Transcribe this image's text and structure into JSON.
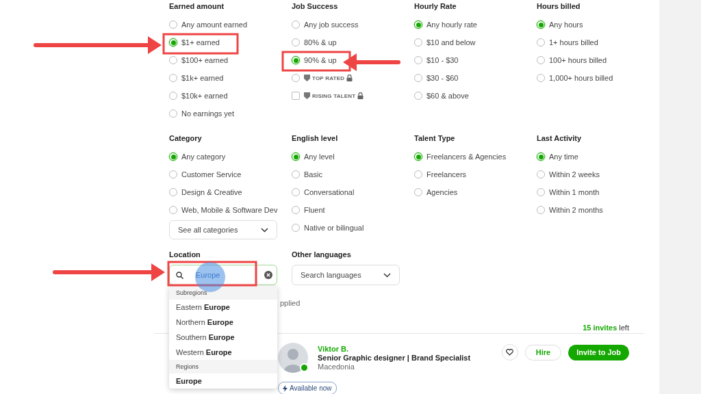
{
  "filters_top": [
    {
      "heading": "Earned amount",
      "options": [
        {
          "label": "Any amount earned",
          "kind": "radio",
          "selected": false
        },
        {
          "label": "$1+ earned",
          "kind": "radio",
          "selected": true
        },
        {
          "label": "$100+ earned",
          "kind": "radio",
          "selected": false
        },
        {
          "label": "$1k+ earned",
          "kind": "radio",
          "selected": false
        },
        {
          "label": "$10k+ earned",
          "kind": "radio",
          "selected": false
        },
        {
          "label": "No earnings yet",
          "kind": "radio",
          "selected": false
        }
      ]
    },
    {
      "heading": "Job Success",
      "options": [
        {
          "label": "Any job success",
          "kind": "radio",
          "selected": false
        },
        {
          "label": "80% & up",
          "kind": "radio",
          "selected": false
        },
        {
          "label": "90% & up",
          "kind": "radio",
          "selected": true
        },
        {
          "label": "TOP RATED",
          "kind": "radio",
          "selected": false,
          "locked": true
        },
        {
          "label": "RISING TALENT",
          "kind": "checkbox",
          "selected": false,
          "locked": true
        }
      ]
    },
    {
      "heading": "Hourly Rate",
      "options": [
        {
          "label": "Any hourly rate",
          "kind": "radio",
          "selected": true
        },
        {
          "label": "$10 and below",
          "kind": "radio",
          "selected": false
        },
        {
          "label": "$10 - $30",
          "kind": "radio",
          "selected": false
        },
        {
          "label": "$30 - $60",
          "kind": "radio",
          "selected": false
        },
        {
          "label": "$60 & above",
          "kind": "radio",
          "selected": false
        }
      ]
    },
    {
      "heading": "Hours billed",
      "options": [
        {
          "label": "Any hours",
          "kind": "radio",
          "selected": true
        },
        {
          "label": "1+ hours billed",
          "kind": "radio",
          "selected": false
        },
        {
          "label": "100+ hours billed",
          "kind": "radio",
          "selected": false
        },
        {
          "label": "1,000+ hours billed",
          "kind": "radio",
          "selected": false
        }
      ]
    }
  ],
  "filters_mid": [
    {
      "heading": "Category",
      "options": [
        {
          "label": "Any category",
          "kind": "radio",
          "selected": true
        },
        {
          "label": "Customer Service",
          "kind": "radio",
          "selected": false
        },
        {
          "label": "Design & Creative",
          "kind": "radio",
          "selected": false
        },
        {
          "label": "Web, Mobile & Software Dev",
          "kind": "radio",
          "selected": false
        }
      ],
      "select": "See all categories"
    },
    {
      "heading": "English level",
      "options": [
        {
          "label": "Any level",
          "kind": "radio",
          "selected": true
        },
        {
          "label": "Basic",
          "kind": "radio",
          "selected": false
        },
        {
          "label": "Conversational",
          "kind": "radio",
          "selected": false
        },
        {
          "label": "Fluent",
          "kind": "radio",
          "selected": false
        },
        {
          "label": "Native or bilingual",
          "kind": "radio",
          "selected": false
        }
      ]
    },
    {
      "heading": "Talent Type",
      "options": [
        {
          "label": "Freelancers & Agencies",
          "kind": "radio",
          "selected": true
        },
        {
          "label": "Freelancers",
          "kind": "radio",
          "selected": false
        },
        {
          "label": "Agencies",
          "kind": "radio",
          "selected": false
        }
      ]
    },
    {
      "heading": "Last Activity",
      "options": [
        {
          "label": "Any time",
          "kind": "radio",
          "selected": true
        },
        {
          "label": "Within 2 weeks",
          "kind": "radio",
          "selected": false
        },
        {
          "label": "Within 1 month",
          "kind": "radio",
          "selected": false
        },
        {
          "label": "Within 2 months",
          "kind": "radio",
          "selected": false
        }
      ]
    }
  ],
  "location": {
    "heading": "Location",
    "value": "Europe",
    "suggestions": [
      {
        "group": "Subregions",
        "items": [
          {
            "text": "Eastern **Europe**",
            "full_match": false
          },
          {
            "text": "Northern **Europe**",
            "full_match": false
          },
          {
            "text": "Southern **Europe**",
            "full_match": false
          },
          {
            "text": "Western **Europe**",
            "full_match": false
          }
        ]
      },
      {
        "group": "Regions",
        "items": [
          {
            "text": "Europe",
            "full_match": true
          }
        ]
      }
    ]
  },
  "other_languages": {
    "heading": "Other languages",
    "placeholder": "Search languages"
  },
  "applied_note": "pplied",
  "invites": {
    "count": "15 invites",
    "suffix": "left"
  },
  "freelancer": {
    "name": "Viktor B.",
    "title": "Senior Graphic designer | Brand Specialist",
    "location": "Macedonia",
    "online": true,
    "badge": "Available now",
    "hire": "Hire",
    "invite": "Invite to Job"
  }
}
